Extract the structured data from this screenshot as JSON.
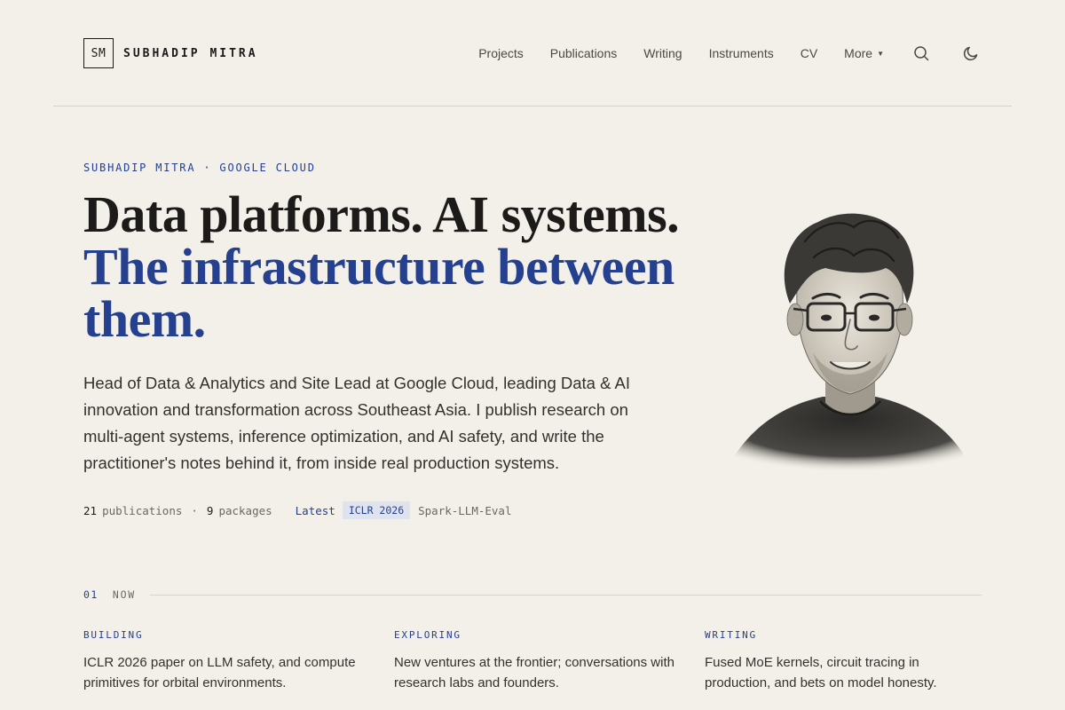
{
  "brand": {
    "monogram": "SM",
    "name": "SUBHADIP MITRA"
  },
  "nav": {
    "items": [
      "Projects",
      "Publications",
      "Writing",
      "Instruments",
      "CV"
    ],
    "more_label": "More",
    "search_icon": "search-icon",
    "theme_icon": "moon-icon"
  },
  "hero": {
    "kicker": "SUBHADIP MITRA · GOOGLE CLOUD",
    "headline_line1": "Data platforms. AI systems.",
    "headline_line2": "The infrastructure between them.",
    "lede": "Head of Data & Analytics and Site Lead at Google Cloud, leading Data & AI innovation and transformation across Southeast Asia. I publish research on multi-agent systems, inference optimization, and AI safety, and write the practitioner's notes behind it, from inside real production systems.",
    "stats": {
      "publications_count": "21",
      "publications_label": "publications",
      "separator": "·",
      "packages_count": "9",
      "packages_label": "packages",
      "latest_label": "Latest",
      "latest_badge": "ICLR 2026",
      "latest_title": "Spark-LLM-Eval"
    }
  },
  "now": {
    "number": "01",
    "label": "NOW",
    "columns": [
      {
        "label": "BUILDING",
        "text": "ICLR 2026 paper on LLM safety, and compute primitives for orbital environments."
      },
      {
        "label": "EXPLORING",
        "text": "New ventures at the frontier; conversations with research labs and founders."
      },
      {
        "label": "WRITING",
        "text": "Fused MoE kernels, circuit tracing in production, and bets on model honesty."
      }
    ]
  },
  "colors": {
    "accent": "#25408f",
    "background": "#f3f0e9",
    "text": "#1c1b19",
    "badge_bg": "#dfe3ee"
  }
}
